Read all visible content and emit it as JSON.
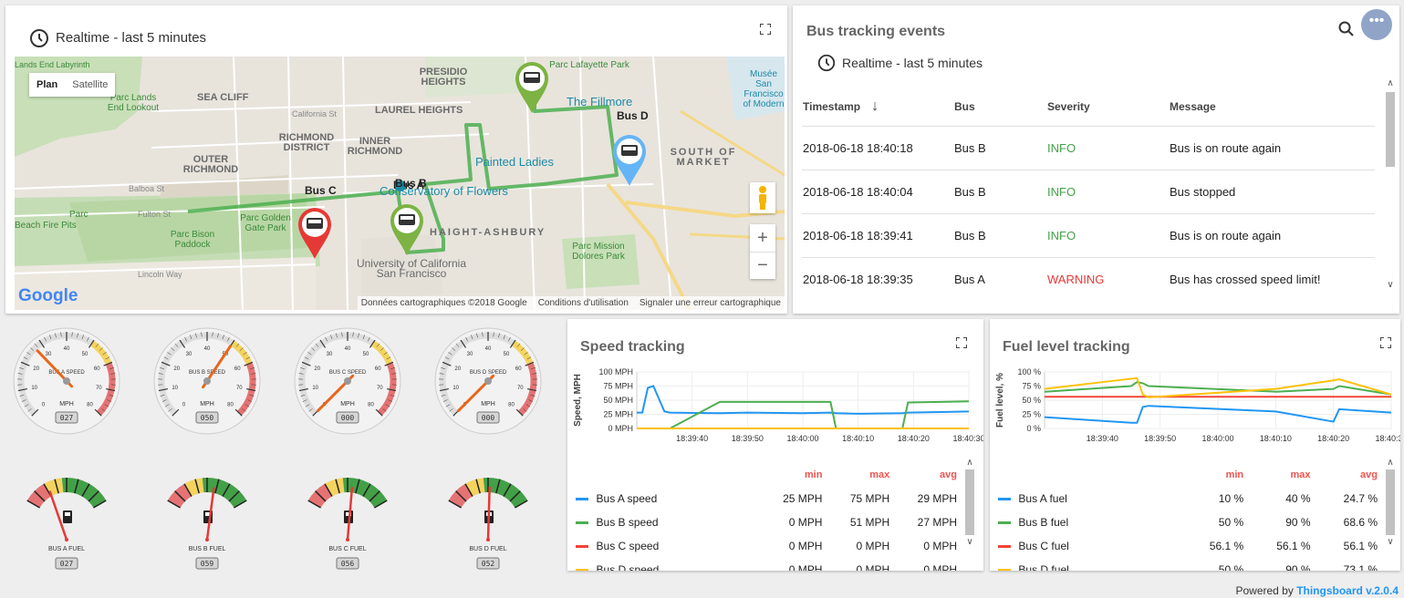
{
  "map_widget": {
    "timewindow": "Realtime - last 5 minutes",
    "map_type_buttons": [
      "Plan",
      "Satellite"
    ],
    "logo": "Google",
    "attribution": "Données cartographiques ©2018 Google",
    "terms": "Conditions d'utilisation",
    "report": "Signaler une erreur cartographique",
    "labels": [
      "Lands End Labyrinth",
      "Parc Lands End Lookout",
      "SEA CLIFF",
      "PRESIDIO HEIGHTS",
      "Parc Lafayette Park",
      "Musée San Francisco of Modern",
      "California St",
      "LAUREL HEIGHTS",
      "The Fillmore",
      "RICHMOND DISTRICT",
      "INNER RICHMOND",
      "OUTER RICHMOND",
      "Painted Ladies",
      "SOUTH OF MARKET",
      "Balboa St",
      "Conservatory of Flowers",
      "Fulton St",
      "Parc Golden Gate Park",
      "Parc Bison Paddock",
      "HAIGHT-ASHBURY",
      "Parc Mission Dolores Park",
      "University of California San Francisco",
      "Lincoln Way",
      "Beach Fire Pits",
      "Parc"
    ],
    "markers": [
      {
        "label": "Bus A",
        "color": "#7cb342"
      },
      {
        "label": "Bus B",
        "color": "#7cb342"
      },
      {
        "label": "Bus C",
        "color": "#e53935"
      },
      {
        "label": "Bus D",
        "color": "#64b5f6"
      }
    ]
  },
  "events_widget": {
    "title": "Bus tracking events",
    "timewindow": "Realtime - last 5 minutes",
    "columns": [
      "Timestamp",
      "Bus",
      "Severity",
      "Message"
    ],
    "rows": [
      {
        "timestamp": "2018-06-18 18:40:18",
        "bus": "Bus B",
        "severity": "INFO",
        "message": "Bus is on route again"
      },
      {
        "timestamp": "2018-06-18 18:40:04",
        "bus": "Bus B",
        "severity": "INFO",
        "message": "Bus stopped"
      },
      {
        "timestamp": "2018-06-18 18:39:41",
        "bus": "Bus B",
        "severity": "INFO",
        "message": "Bus is on route again"
      },
      {
        "timestamp": "2018-06-18 18:39:35",
        "bus": "Bus A",
        "severity": "WARNING",
        "message": "Bus has crossed speed limit!"
      }
    ],
    "colors": {
      "info": "#43a047",
      "warning": "#e53935"
    }
  },
  "speed_gauges": [
    {
      "label": "BUS A SPEED",
      "value": "027",
      "speed": 27
    },
    {
      "label": "BUS B SPEED",
      "value": "050",
      "speed": 50
    },
    {
      "label": "BUS C SPEED",
      "value": "000",
      "speed": 0
    },
    {
      "label": "BUS D SPEED",
      "value": "000",
      "speed": 0
    }
  ],
  "speed_gauge_unit": "MPH",
  "speed_gauge_ticks": [
    "0",
    "10",
    "20",
    "30",
    "40",
    "50",
    "60",
    "70",
    "80"
  ],
  "fuel_gauges": [
    {
      "label": "BUS A FUEL",
      "value": "027",
      "level": 27
    },
    {
      "label": "BUS B FUEL",
      "value": "059",
      "level": 59
    },
    {
      "label": "BUS C FUEL",
      "value": "056",
      "level": 56
    },
    {
      "label": "BUS D FUEL",
      "value": "052",
      "level": 52
    }
  ],
  "speed_chart": {
    "title": "Speed tracking",
    "legend_headers": [
      "min",
      "max",
      "avg"
    ],
    "legend": [
      {
        "name": "Bus A speed",
        "min": "25 MPH",
        "max": "75 MPH",
        "avg": "29 MPH",
        "color": "#2196f3"
      },
      {
        "name": "Bus B speed",
        "min": "0 MPH",
        "max": "51 MPH",
        "avg": "27 MPH",
        "color": "#4caf50"
      },
      {
        "name": "Bus C speed",
        "min": "0 MPH",
        "max": "0 MPH",
        "avg": "0 MPH",
        "color": "#f44336"
      },
      {
        "name": "Bus D speed",
        "min": "0 MPH",
        "max": "0 MPH",
        "avg": "0 MPH",
        "color": "#ffc107"
      }
    ]
  },
  "fuel_chart": {
    "title": "Fuel level tracking",
    "legend_headers": [
      "min",
      "max",
      "avg"
    ],
    "legend": [
      {
        "name": "Bus A fuel",
        "min": "10 %",
        "max": "40 %",
        "avg": "24.7 %",
        "color": "#2196f3"
      },
      {
        "name": "Bus B fuel",
        "min": "50 %",
        "max": "90 %",
        "avg": "68.6 %",
        "color": "#4caf50"
      },
      {
        "name": "Bus C fuel",
        "min": "56.1 %",
        "max": "56.1 %",
        "avg": "56.1 %",
        "color": "#f44336"
      },
      {
        "name": "Bus D fuel",
        "min": "50 %",
        "max": "90 %",
        "avg": "73.1 %",
        "color": "#ffc107"
      }
    ]
  },
  "chart_data": [
    {
      "type": "line",
      "title": "Speed tracking",
      "xlabel": "",
      "ylabel": "Speed, MPH",
      "ylim": [
        0,
        100
      ],
      "yticks": [
        "0 MPH",
        "25 MPH",
        "50 MPH",
        "75 MPH",
        "100 MPH"
      ],
      "xticks": [
        "18:39:40",
        "18:39:50",
        "18:40:00",
        "18:40:10",
        "18:40:20",
        "18:40:30"
      ],
      "x": [
        "18:39:30",
        "18:39:31",
        "18:39:32",
        "18:39:33",
        "18:39:35",
        "18:39:36",
        "18:39:45",
        "18:39:50",
        "18:40:00",
        "18:40:05",
        "18:40:06",
        "18:40:10",
        "18:40:18",
        "18:40:19",
        "18:40:25",
        "18:40:30"
      ],
      "series": [
        {
          "name": "Bus A speed",
          "values": [
            28,
            28,
            72,
            75,
            30,
            28,
            27,
            28,
            27,
            28,
            27,
            26,
            27,
            28,
            29,
            30
          ]
        },
        {
          "name": "Bus B speed",
          "values": [
            0,
            0,
            0,
            0,
            0,
            0,
            47,
            47,
            47,
            47,
            0,
            0,
            0,
            46,
            47,
            48
          ]
        },
        {
          "name": "Bus C speed",
          "values": [
            0,
            0,
            0,
            0,
            0,
            0,
            0,
            0,
            0,
            0,
            0,
            0,
            0,
            0,
            0,
            0
          ]
        },
        {
          "name": "Bus D speed",
          "values": [
            0,
            0,
            0,
            0,
            0,
            0,
            0,
            0,
            0,
            0,
            0,
            0,
            0,
            0,
            0,
            0
          ]
        }
      ]
    },
    {
      "type": "line",
      "title": "Fuel level tracking",
      "xlabel": "",
      "ylabel": "Fuel level, %",
      "ylim": [
        0,
        100
      ],
      "yticks": [
        "0 %",
        "25 %",
        "50 %",
        "75 %",
        "100 %"
      ],
      "xticks": [
        "18:39:40",
        "18:39:50",
        "18:40:00",
        "18:40:10",
        "18:40:20",
        "18:40:30"
      ],
      "x": [
        "18:39:30",
        "18:39:45",
        "18:39:46",
        "18:39:47",
        "18:39:48",
        "18:40:10",
        "18:40:20",
        "18:40:21",
        "18:40:30"
      ],
      "series": [
        {
          "name": "Bus A fuel",
          "values": [
            20,
            10,
            10,
            38,
            40,
            30,
            12,
            34,
            28
          ]
        },
        {
          "name": "Bus B fuel",
          "values": [
            65,
            75,
            82,
            80,
            75,
            65,
            70,
            75,
            60
          ]
        },
        {
          "name": "Bus C fuel",
          "values": [
            56,
            56,
            56,
            56,
            56,
            56,
            56,
            56,
            56
          ]
        },
        {
          "name": "Bus D fuel",
          "values": [
            70,
            88,
            89,
            60,
            55,
            70,
            85,
            87,
            60
          ]
        }
      ]
    }
  ],
  "footer": {
    "prefix": "Powered by",
    "brand": "Thingsboard v.2.0.4"
  }
}
